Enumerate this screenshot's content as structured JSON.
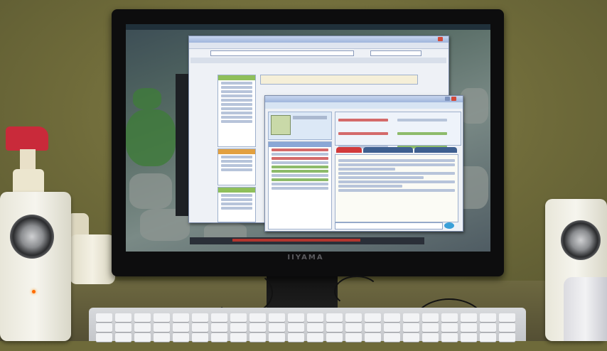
{
  "scene": {
    "monitor_brand": "IIYAMA",
    "objects": [
      "monitor",
      "speaker-left",
      "speaker-right",
      "keyboard",
      "spray-bottle",
      "jars",
      "cup"
    ],
    "colors": {
      "wall": "#77733f",
      "bezel": "#0d0d0e",
      "window_title": "#9fb5dc",
      "spray_head": "#c92a3a",
      "led": "#ff6a00"
    }
  },
  "screen": {
    "windows": [
      {
        "name": "browser-window",
        "icon": "browser-icon"
      },
      {
        "name": "messenger-window",
        "icon": "messenger-icon"
      }
    ]
  }
}
